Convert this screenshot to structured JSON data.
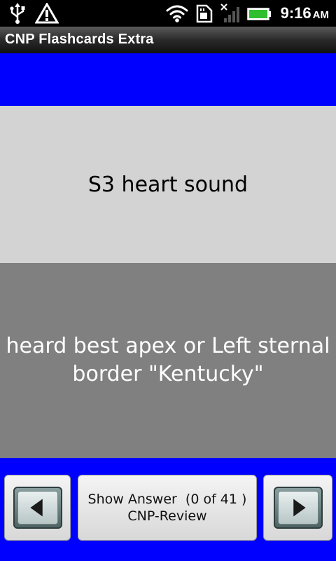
{
  "status_bar": {
    "time": "9:16",
    "ampm": "AM",
    "icons": [
      "usb-icon",
      "warning-icon",
      "wifi-icon",
      "sd-card-icon",
      "signal-off-icon",
      "battery-icon"
    ]
  },
  "app": {
    "title": "CNP Flashcards Extra"
  },
  "card": {
    "question": "S3 heart sound",
    "answer": "heard best apex or Left sternal border \"Kentucky\""
  },
  "controls": {
    "show_answer_line1": "Show Answer  (0 of 41 )",
    "show_answer_line2": "CNP-Review",
    "prev_icon": "arrow-left-icon",
    "next_icon": "arrow-right-icon"
  },
  "colors": {
    "accent_blue": "#0000ff",
    "question_bg": "#d3d3d3",
    "answer_bg": "#808080"
  }
}
